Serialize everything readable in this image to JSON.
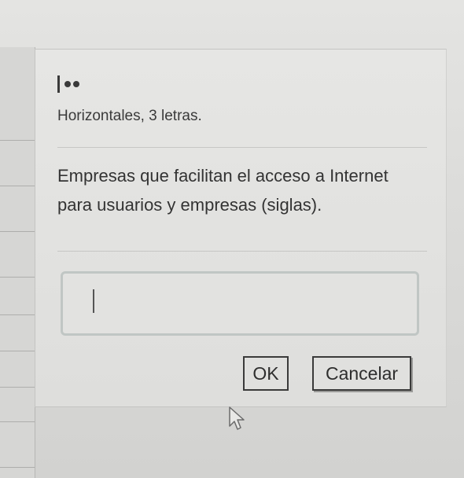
{
  "dialog": {
    "clue_number": "1",
    "direction": "Horizontales, 3 letras.",
    "clue": "Empresas que facilitan el acceso a Internet para usuarios y empresas (siglas).",
    "answer": {
      "value": "",
      "placeholder": ""
    },
    "ok_label": "OK",
    "cancel_label": "Cancelar"
  },
  "icons": {
    "cursor": "mouse-pointer-icon",
    "text_caret": "text-caret"
  },
  "colors": {
    "dialog_background": "#e2e2e0",
    "text": "#333333",
    "input_border": "#c0c6c4"
  }
}
